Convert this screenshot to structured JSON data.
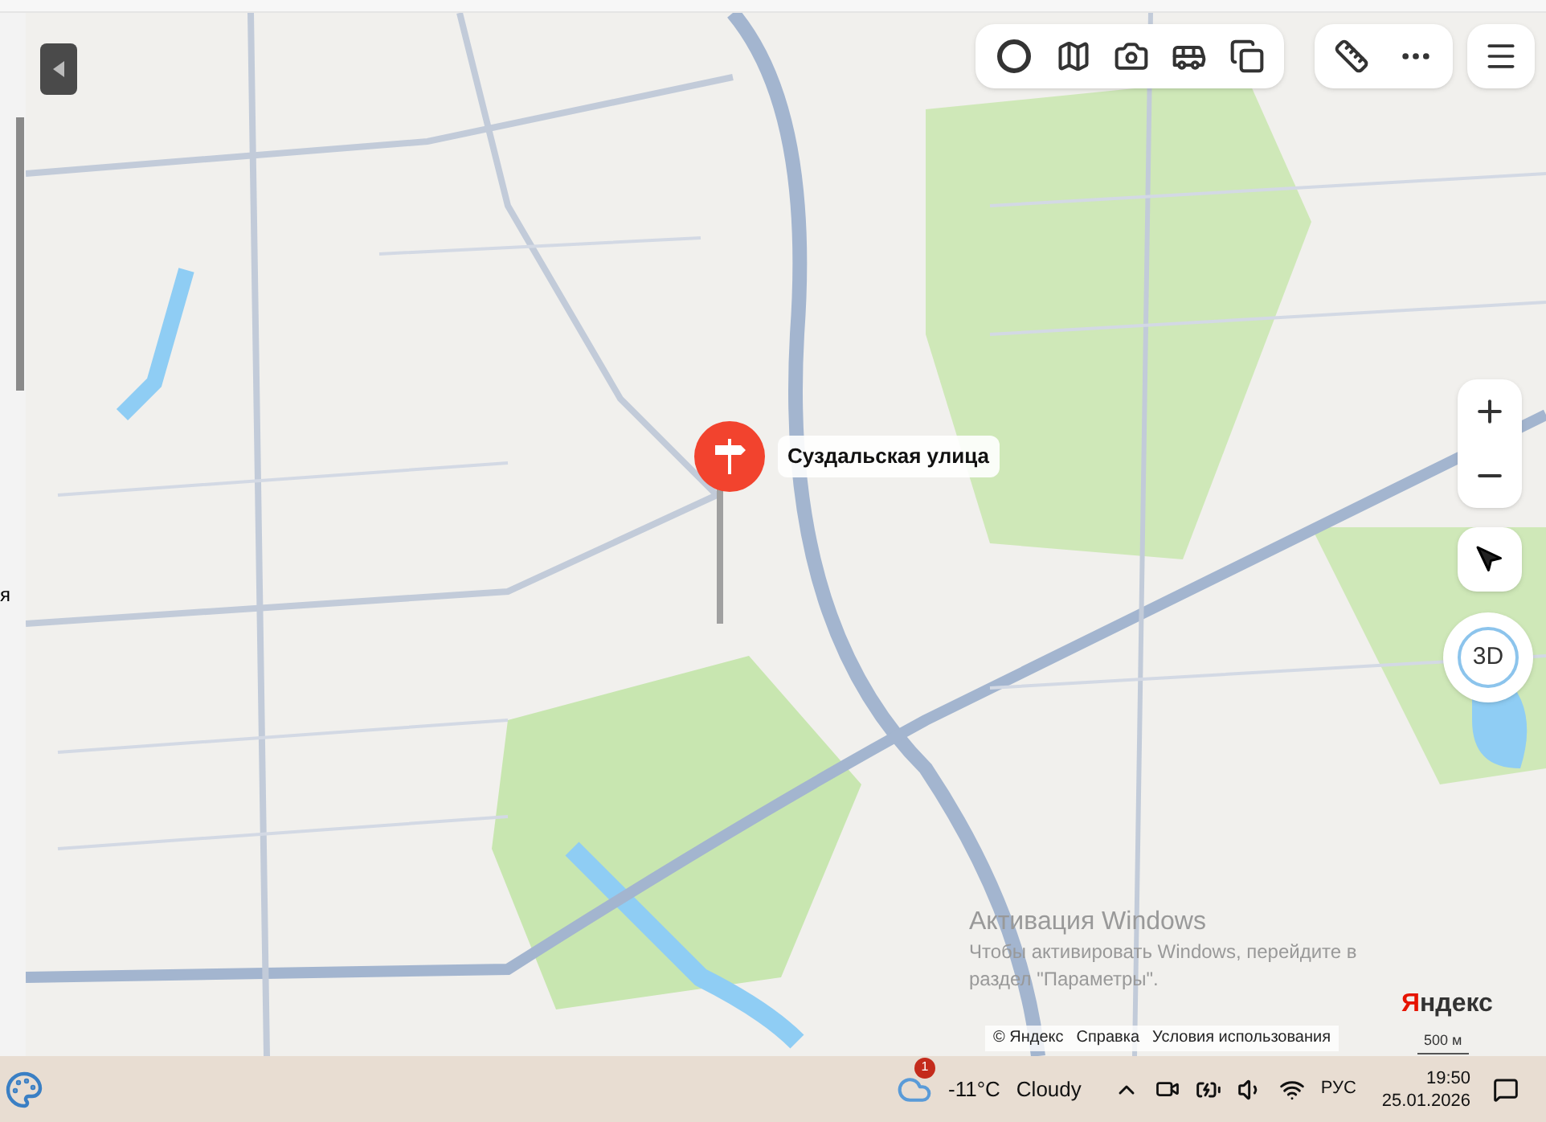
{
  "left_panel": {
    "text": "я"
  },
  "map": {
    "marker": {
      "label": "Суздальская улица"
    },
    "zoom_control": {
      "label": "3D"
    },
    "logo": "Яндекс",
    "scale": "500 м",
    "attribution": [
      "© Яндекс",
      "Справка",
      "Условия использования"
    ]
  },
  "activation_notice": {
    "title": "Активация Windows",
    "text": "Чтобы активировать Windows, перейдите в раздел \"Параметры\"."
  },
  "taskbar": {
    "weather": {
      "badge": "1",
      "temperature": "-11°C",
      "condition": "Cloudy"
    },
    "language": "РУС",
    "time": "19:50",
    "date": "25.01.2026"
  }
}
